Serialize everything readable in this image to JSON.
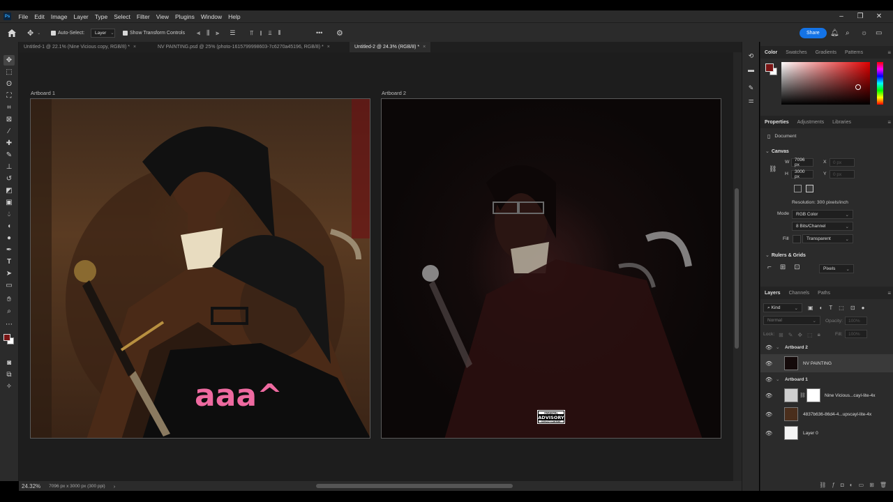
{
  "app": {
    "logo": "Ps",
    "menu": [
      "File",
      "Edit",
      "Image",
      "Layer",
      "Type",
      "Select",
      "Filter",
      "View",
      "Plugins",
      "Window",
      "Help"
    ],
    "window_controls": {
      "minimize": "–",
      "restore": "❐",
      "close": "✕"
    }
  },
  "options_bar": {
    "auto_select_label": "Auto-Select:",
    "auto_select_target": "Layer",
    "show_transform_label": "Show Transform Controls",
    "more": "•••",
    "share_label": "Share"
  },
  "tabs": [
    {
      "label": "Untitled-1 @ 22.1% (Nine Vicious copy, RGB/8) *",
      "close": "×"
    },
    {
      "label": "NV PAINTING.psd @ 25% (photo-1615799998603-7c6270a45196, RGB/8) *",
      "close": "×"
    },
    {
      "label": "Untitled-2 @ 24.3% (RGB/8) *",
      "close": "×",
      "active": true
    }
  ],
  "canvas": {
    "artboard1_label": "Artboard 1",
    "artboard2_label": "Artboard 2",
    "ab1_shirt_text": "aaa^",
    "advisory": {
      "line1": "PARENTAL",
      "line2": "ADVISORY",
      "line3": "EXPLICIT CONTENT"
    }
  },
  "status": {
    "zoom": "24.32%",
    "doc_info": "7096 px x 3000 px (300 ppi)",
    "nav": "›"
  },
  "color_panel": {
    "tabs": [
      "Color",
      "Swatches",
      "Gradients",
      "Patterns"
    ],
    "foreground": "#7a1414",
    "background": "#ffffff"
  },
  "properties_panel": {
    "tabs": [
      "Properties",
      "Adjustments",
      "Libraries"
    ],
    "doc_label": "Document",
    "canvas_header": "Canvas",
    "w_label": "W",
    "w_value": "7096 px",
    "h_label": "H",
    "h_value": "3000 px",
    "x_label": "X",
    "x_value": "0 px",
    "y_label": "Y",
    "y_value": "0 px",
    "resolution": "Resolution: 300 pixels/inch",
    "mode_label": "Mode",
    "mode_value": "RGB Color",
    "bits_value": "8 Bits/Channel",
    "fill_label": "Fill",
    "fill_value": "Transparent",
    "rulers_header": "Rulers & Grids",
    "units_value": "Pixels"
  },
  "layers_panel": {
    "tabs": [
      "Layers",
      "Channels",
      "Paths"
    ],
    "kind_label": "Kind",
    "blend_mode": "Normal",
    "opacity_label": "Opacity:",
    "opacity_value": "100%",
    "lock_label": "Lock:",
    "fill_label": "Fill:",
    "fill_value": "100%",
    "layers": [
      {
        "name": "Artboard 2",
        "type": "group"
      },
      {
        "name": "NV PAINTING",
        "type": "layer"
      },
      {
        "name": "Artboard 1",
        "type": "group"
      },
      {
        "name": "Nine Vicious...cayl-lite-4x",
        "type": "layer"
      },
      {
        "name": "4837b636-86d4-4...upscayl-lite-4x",
        "type": "layer"
      },
      {
        "name": "Layer 0",
        "type": "layer"
      }
    ]
  }
}
